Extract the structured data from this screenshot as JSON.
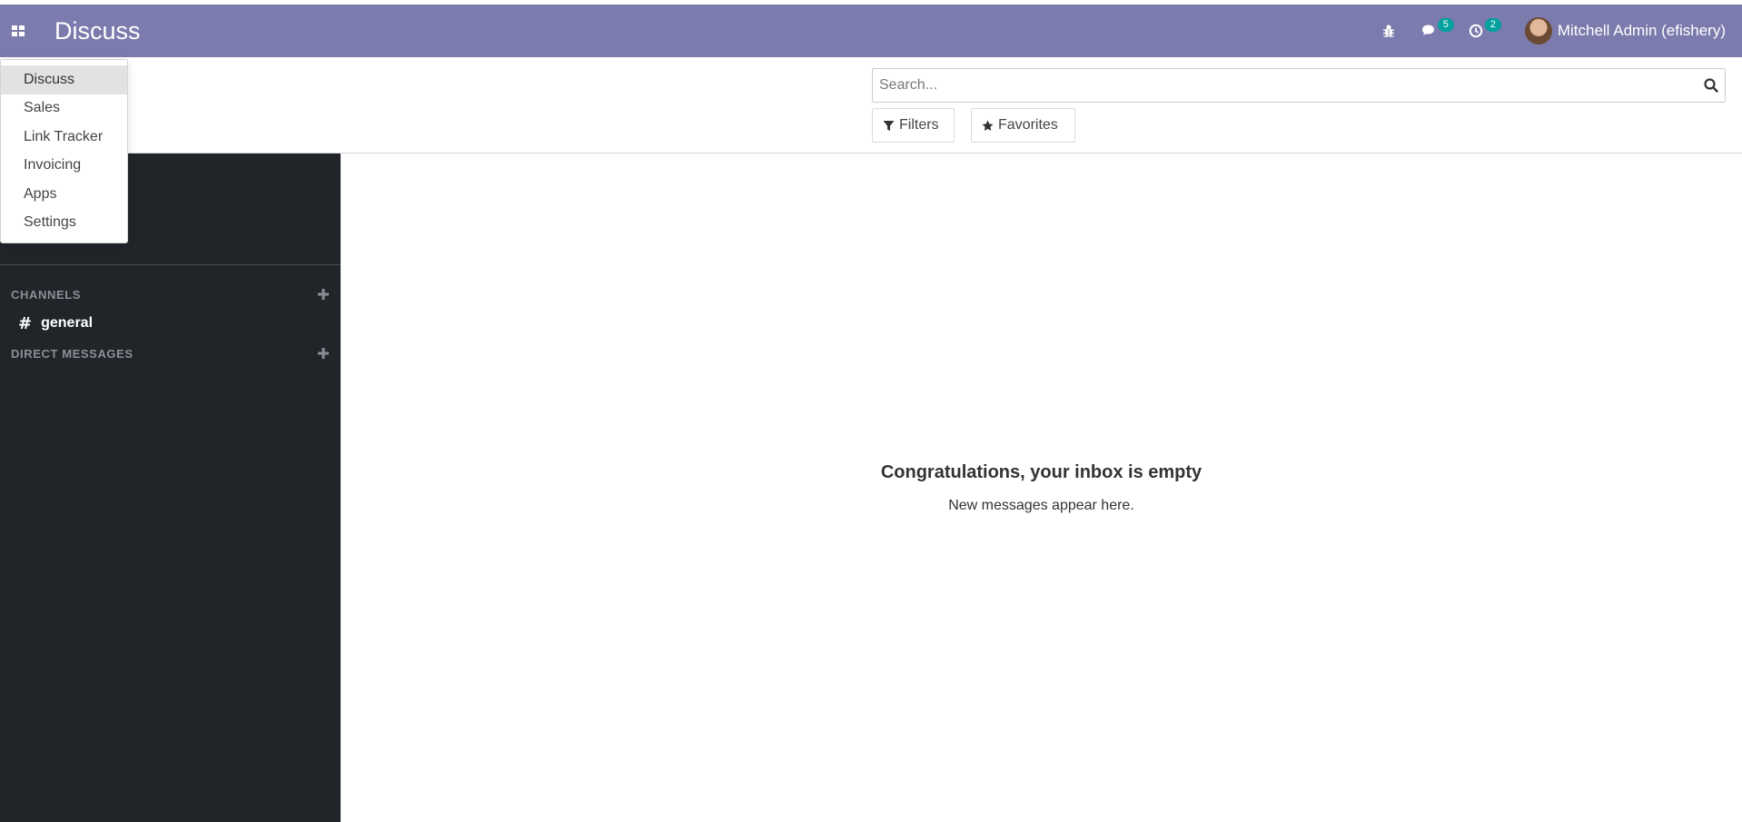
{
  "navbar": {
    "app_title": "Discuss",
    "apps_icon": "grid-icon",
    "background": "#7c7bad",
    "systray": [
      {
        "icon": "bug-icon",
        "badge": ""
      },
      {
        "icon": "comments-icon",
        "badge": "5"
      },
      {
        "icon": "clock-icon",
        "badge": "2"
      }
    ],
    "user": {
      "name": "Mitchell Admin (efishery)"
    }
  },
  "app_menu": {
    "items": [
      {
        "label": "Discuss",
        "active": true
      },
      {
        "label": "Sales"
      },
      {
        "label": "Link Tracker"
      },
      {
        "label": "Invoicing"
      },
      {
        "label": "Apps"
      },
      {
        "label": "Settings"
      }
    ]
  },
  "control_panel": {
    "search": {
      "placeholder": "Search...",
      "value": ""
    },
    "filters_label": "Filters",
    "favorites_label": "Favorites"
  },
  "sidebar": {
    "channels_label": "CHANNELS",
    "channels": [
      {
        "name": "general"
      }
    ],
    "direct_messages_label": "DIRECT MESSAGES"
  },
  "content": {
    "empty_title": "Congratulations, your inbox is empty",
    "empty_subtitle": "New messages appear here."
  },
  "colors": {
    "navbar": "#7c7bad",
    "sidebar": "#212529",
    "badge": "#00a09d"
  }
}
